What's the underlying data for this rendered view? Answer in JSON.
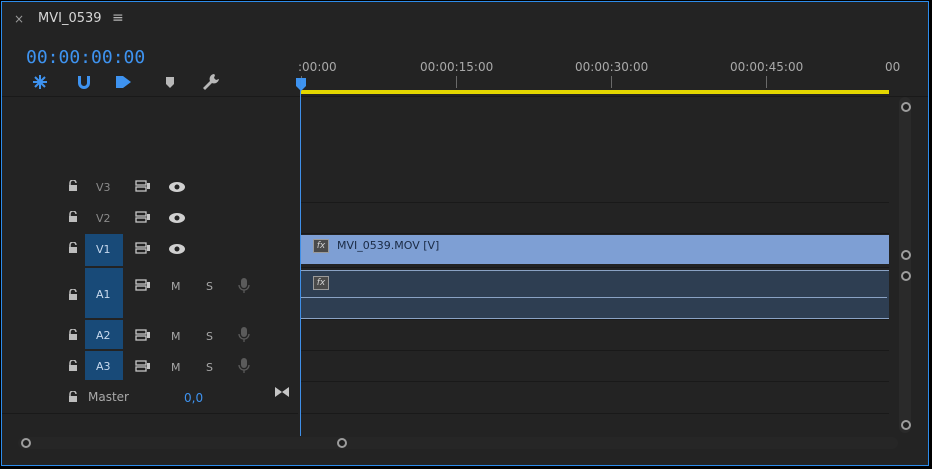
{
  "tab": {
    "close": "×",
    "title": "MVI_0539",
    "menu": "≡"
  },
  "timecode": "00:00:00:00",
  "tools": [
    "snap-icon",
    "magnet-icon",
    "linked-selection-icon",
    "marker-icon",
    "wrench-icon"
  ],
  "ruler": {
    "labels": [
      ":00:00",
      "00:00:15:00",
      "00:00:30:00",
      "00:00:45:00",
      "00"
    ]
  },
  "tracks": {
    "v3": {
      "label": "V3"
    },
    "v2": {
      "label": "V2"
    },
    "v1": {
      "label": "V1"
    },
    "a1": {
      "label": "A1",
      "m": "M",
      "s": "S"
    },
    "a2": {
      "label": "A2",
      "m": "M",
      "s": "S"
    },
    "a3": {
      "label": "A3",
      "m": "M",
      "s": "S"
    },
    "master": {
      "label": "Master",
      "value": "0,0"
    }
  },
  "clips": {
    "video": {
      "fx": "fx",
      "name": "MVI_0539.MOV [V]"
    },
    "audio": {
      "fx": "fx"
    }
  },
  "colors": {
    "accent": "#3e93f0",
    "target": "#184a78",
    "yellow": "#e3d600",
    "clip_video": "#7e9fd4",
    "clip_audio": "#2e3e52"
  }
}
